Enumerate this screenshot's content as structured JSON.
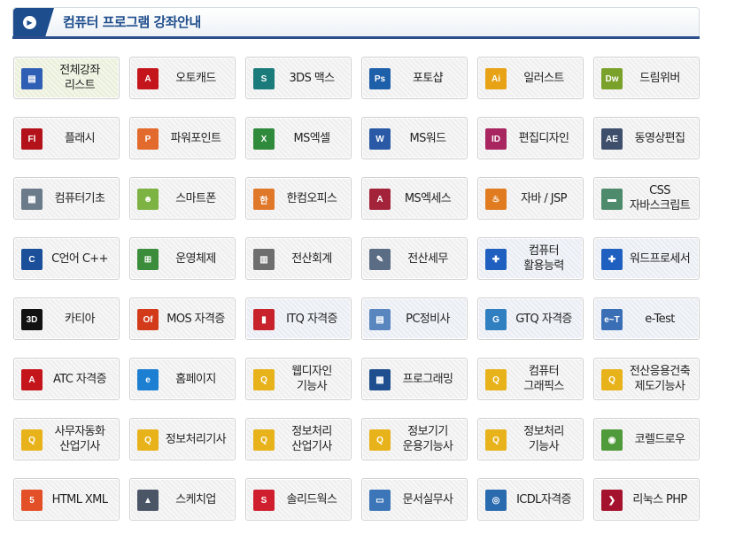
{
  "header": {
    "title": "컴퓨터 프로그램 강좌안내",
    "badge_icon": "circle-arrow-icon"
  },
  "courses": [
    {
      "label": "전체강좌\n리스트",
      "icon": "course-list-icon",
      "color": "#2f5fb4",
      "glyph": "▤",
      "style": "active"
    },
    {
      "label": "오토캐드",
      "icon": "autocad-icon",
      "color": "#c4151c",
      "glyph": "A",
      "style": ""
    },
    {
      "label": "3DS 맥스",
      "icon": "3dsmax-icon",
      "color": "#1b7a7a",
      "glyph": "S",
      "style": ""
    },
    {
      "label": "포토샵",
      "icon": "photoshop-icon",
      "color": "#1d5fa8",
      "glyph": "Ps",
      "style": ""
    },
    {
      "label": "일러스트",
      "icon": "illustrator-icon",
      "color": "#e8a215",
      "glyph": "Ai",
      "style": ""
    },
    {
      "label": "드림위버",
      "icon": "dreamweaver-icon",
      "color": "#7aa22a",
      "glyph": "Dw",
      "style": ""
    },
    {
      "label": "플래시",
      "icon": "flash-icon",
      "color": "#b3121a",
      "glyph": "Fl",
      "style": ""
    },
    {
      "label": "파워포인트",
      "icon": "powerpoint-icon",
      "color": "#e26a2c",
      "glyph": "P",
      "style": ""
    },
    {
      "label": "MS엑셀",
      "icon": "excel-icon",
      "color": "#2f8a3c",
      "glyph": "X",
      "style": ""
    },
    {
      "label": "MS워드",
      "icon": "word-icon",
      "color": "#2a5aa6",
      "glyph": "W",
      "style": ""
    },
    {
      "label": "편집디자인",
      "icon": "indesign-icon",
      "color": "#a8255f",
      "glyph": "ID",
      "style": ""
    },
    {
      "label": "동영상편집",
      "icon": "aftereffects-icon",
      "color": "#3e4f6b",
      "glyph": "AE",
      "style": ""
    },
    {
      "label": "컴퓨터기초",
      "icon": "computer-basics-icon",
      "color": "#6b7b8a",
      "glyph": "▦",
      "style": ""
    },
    {
      "label": "스마트폰",
      "icon": "android-icon",
      "color": "#7cb342",
      "glyph": "☻",
      "style": ""
    },
    {
      "label": "한컴오피스",
      "icon": "hancom-office-icon",
      "color": "#e0782a",
      "glyph": "한",
      "style": ""
    },
    {
      "label": "MS엑세스",
      "icon": "access-icon",
      "color": "#a3243a",
      "glyph": "A",
      "style": ""
    },
    {
      "label": "자바 / JSP",
      "icon": "java-icon",
      "color": "#e07b20",
      "glyph": "♨",
      "style": ""
    },
    {
      "label": "CSS\n자바스크립트",
      "icon": "css-javascript-icon",
      "color": "#4e8a6c",
      "glyph": "▬",
      "style": ""
    },
    {
      "label": "C언어 C++",
      "icon": "c-language-icon",
      "color": "#1b4f9a",
      "glyph": "C",
      "style": ""
    },
    {
      "label": "운영체제",
      "icon": "windows-icon",
      "color": "#3b8d3b",
      "glyph": "⊞",
      "style": ""
    },
    {
      "label": "전산회계",
      "icon": "accounting-icon",
      "color": "#6e6e6e",
      "glyph": "▥",
      "style": ""
    },
    {
      "label": "전산세무",
      "icon": "tax-icon",
      "color": "#5b6d85",
      "glyph": "✎",
      "style": ""
    },
    {
      "label": "컴퓨터\n활용능력",
      "icon": "puzzle-icon",
      "color": "#1f5fbf",
      "glyph": "✚",
      "style": "tinted"
    },
    {
      "label": "워드프로세서",
      "icon": "puzzle-icon",
      "color": "#1f5fbf",
      "glyph": "✚",
      "style": "tinted"
    },
    {
      "label": "카티아",
      "icon": "catia-icon",
      "color": "#111111",
      "glyph": "3D",
      "style": ""
    },
    {
      "label": "MOS 자격증",
      "icon": "mos-icon",
      "color": "#d23a1a",
      "glyph": "Of",
      "style": ""
    },
    {
      "label": "ITQ 자격증",
      "icon": "itq-icon",
      "color": "#c8232c",
      "glyph": "▮",
      "style": "tinted"
    },
    {
      "label": "PC정비사",
      "icon": "pc-repair-icon",
      "color": "#5a86c0",
      "glyph": "▤",
      "style": "tinted"
    },
    {
      "label": "GTQ 자격증",
      "icon": "gtq-icon",
      "color": "#2f7fc1",
      "glyph": "G",
      "style": "tinted"
    },
    {
      "label": "e-Test",
      "icon": "etest-icon",
      "color": "#3a6fb5",
      "glyph": "e~T",
      "style": "tinted"
    },
    {
      "label": "ATC 자격증",
      "icon": "autocad-icon",
      "color": "#c4151c",
      "glyph": "A",
      "style": ""
    },
    {
      "label": "홈페이지",
      "icon": "internet-explorer-icon",
      "color": "#1c7fd1",
      "glyph": "e",
      "style": ""
    },
    {
      "label": "웹디자인\n기능사",
      "icon": "qnet-icon",
      "color": "#e8b21a",
      "glyph": "Q",
      "style": ""
    },
    {
      "label": "프로그래밍",
      "icon": "programming-icon",
      "color": "#1f4f8e",
      "glyph": "▦",
      "style": ""
    },
    {
      "label": "컴퓨터\n그래픽스",
      "icon": "qnet-icon",
      "color": "#e8b21a",
      "glyph": "Q",
      "style": ""
    },
    {
      "label": "전산응용건축\n제도기능사",
      "icon": "qnet-icon",
      "color": "#e8b21a",
      "glyph": "Q",
      "style": ""
    },
    {
      "label": "사무자동화\n산업기사",
      "icon": "qnet-icon",
      "color": "#e8b21a",
      "glyph": "Q",
      "style": ""
    },
    {
      "label": "정보처리기사",
      "icon": "qnet-icon",
      "color": "#e8b21a",
      "glyph": "Q",
      "style": ""
    },
    {
      "label": "정보처리\n산업기사",
      "icon": "qnet-icon",
      "color": "#e8b21a",
      "glyph": "Q",
      "style": ""
    },
    {
      "label": "정보기기\n운용기능사",
      "icon": "qnet-icon",
      "color": "#e8b21a",
      "glyph": "Q",
      "style": ""
    },
    {
      "label": "정보처리\n기능사",
      "icon": "qnet-icon",
      "color": "#e8b21a",
      "glyph": "Q",
      "style": ""
    },
    {
      "label": "코렐드로우",
      "icon": "coreldraw-icon",
      "color": "#4f9a3a",
      "glyph": "◉",
      "style": ""
    },
    {
      "label": "HTML XML",
      "icon": "html5-icon",
      "color": "#e34f26",
      "glyph": "5",
      "style": ""
    },
    {
      "label": "스케치업",
      "icon": "sketchup-icon",
      "color": "#4a5566",
      "glyph": "▲",
      "style": ""
    },
    {
      "label": "솔리드웍스",
      "icon": "solidworks-icon",
      "color": "#cf1f2e",
      "glyph": "S",
      "style": ""
    },
    {
      "label": "문서실무사",
      "icon": "document-icon",
      "color": "#3c76b8",
      "glyph": "▭",
      "style": ""
    },
    {
      "label": "ICDL자격증",
      "icon": "icdl-icon",
      "color": "#2a6bb0",
      "glyph": "◎",
      "style": ""
    },
    {
      "label": "리눅스 PHP",
      "icon": "linux-php-icon",
      "color": "#a5122d",
      "glyph": "❯",
      "style": ""
    }
  ]
}
